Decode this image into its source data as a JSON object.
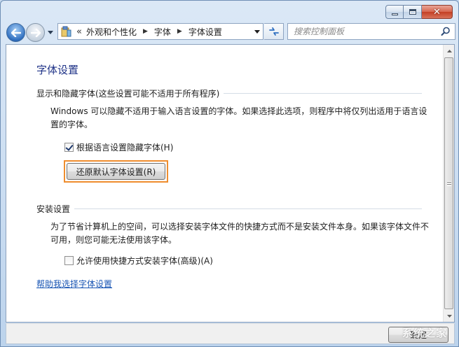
{
  "window": {
    "caption_buttons": {
      "minimize_icon": "minimize-icon",
      "maximize_icon": "maximize-icon",
      "close_icon": "close-icon"
    }
  },
  "navbar": {
    "overflow_glyph": "«",
    "breadcrumbs": [
      "外观和个性化",
      "字体",
      "字体设置"
    ],
    "search_placeholder": "搜索控制面板"
  },
  "page": {
    "title": "字体设置",
    "section_hide": {
      "heading": "显示和隐藏字体(这些设置可能不适用于所有程序)",
      "description": "Windows 可以隐藏不适用于输入语言设置的字体。如果选择此选项，则程序中将仅列出适用于语言设置的字体。",
      "checkbox_label": "根据语言设置隐藏字体(H)",
      "checkbox_checked": true,
      "restore_button": "还原默认字体设置(R)"
    },
    "section_install": {
      "heading": "安装设置",
      "description": "为了节省计算机上的空间，可以选择安装字体文件的快捷方式而不是安装文件本身。如果该字体文件不可用，则您可能无法使用该字体。",
      "checkbox_label": "允许使用快捷方式安装字体(高级)(A)",
      "checkbox_checked": false
    },
    "help_link": "帮助我选择字体设置"
  },
  "footer": {
    "ok_button": "确定",
    "watermark": "系统之家"
  },
  "colors": {
    "title_blue": "#1e3287",
    "link_blue": "#1a56b4",
    "highlight_orange": "#ef8d2e"
  }
}
